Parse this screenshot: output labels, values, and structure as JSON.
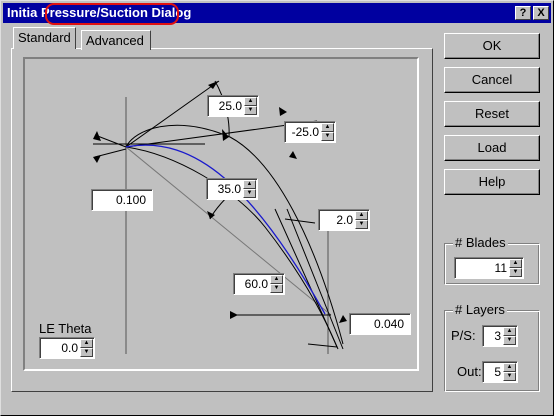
{
  "window": {
    "title_prefix": "Initia",
    "title_highlight": "Pressure/Suction",
    "title_suffix": "Dialog",
    "help_glyph": "?",
    "close_glyph": "X"
  },
  "tabs": [
    {
      "label": "Standard",
      "active": true
    },
    {
      "label": "Advanced",
      "active": false
    }
  ],
  "diagram": {
    "spinners": [
      {
        "name": "top-angle",
        "value": "25.0"
      },
      {
        "name": "right-angle",
        "value": "-25.0"
      },
      {
        "name": "mid-angle",
        "value": "35.0"
      },
      {
        "name": "offset-angle",
        "value": "2.0"
      },
      {
        "name": "lower-angle",
        "value": "60.0"
      }
    ],
    "fields": {
      "le_thickness": "0.100",
      "te_thickness": "0.040"
    },
    "le_theta": {
      "label": "LE Theta",
      "value": "0.0"
    }
  },
  "buttons": {
    "ok": "OK",
    "cancel": "Cancel",
    "reset": "Reset",
    "load": "Load",
    "help": "Help"
  },
  "blades": {
    "label": "# Blades",
    "value": "11"
  },
  "layers": {
    "label": "# Layers",
    "ps_label": "P/S:",
    "ps_value": "3",
    "out_label": "Out:",
    "out_value": "5"
  },
  "colors": {
    "titlebar": "#0000a0",
    "highlight": "#e01010",
    "camber_line": "#1a1acc",
    "face": "#c0c0c0"
  }
}
